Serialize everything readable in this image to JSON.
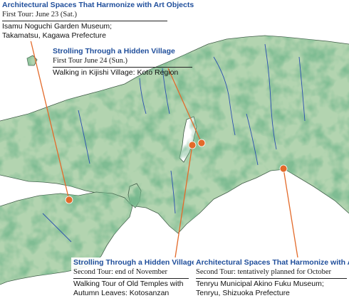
{
  "colors": {
    "sea": "#ffffff",
    "land_light": "#e3efe1",
    "land_mid": "#b3d4b0",
    "land_dark": "#5fa06a",
    "land_darkest": "#2f7a45",
    "coast": "#3f5a46",
    "river": "#2a4fb0",
    "leader": "#e36a2a",
    "marker": "#e36a2a",
    "title_text": "#1f4e9b"
  },
  "callouts": {
    "noguchi": {
      "title": "Architectural Spaces That Harmonize with Art Objects",
      "subtitle": "First Tour: June 23 (Sat.)",
      "body": "Isamu Noguchi Garden Museum; Takamatsu, Kagawa Prefecture"
    },
    "kijishi": {
      "title": "Strolling Through a Hidden Village",
      "subtitle": "First Tour June 24 (Sun.)",
      "body": "Walking in Kijishi Village: Koto Region"
    },
    "kotosanzan": {
      "title": "Strolling Through a Hidden Village",
      "subtitle": "Second Tour: end of November",
      "body": "Walking Tour of Old Temples with Autumn Leaves: Kotosanzan"
    },
    "akino": {
      "title": "Architectural Spaces That Harmonize with Art Objects",
      "subtitle": "Second Tour: tentatively planned for October",
      "body": "Tenryu Municipal Akino Fuku Museum; Tenryu, Shizuoka Prefecture"
    }
  },
  "markers": [
    {
      "name": "takamatsu-marker",
      "label": ""
    },
    {
      "name": "kijishi-marker",
      "label": ""
    },
    {
      "name": "kotosanzan-marker",
      "label": ""
    },
    {
      "name": "tenryu-marker",
      "label": ""
    }
  ]
}
